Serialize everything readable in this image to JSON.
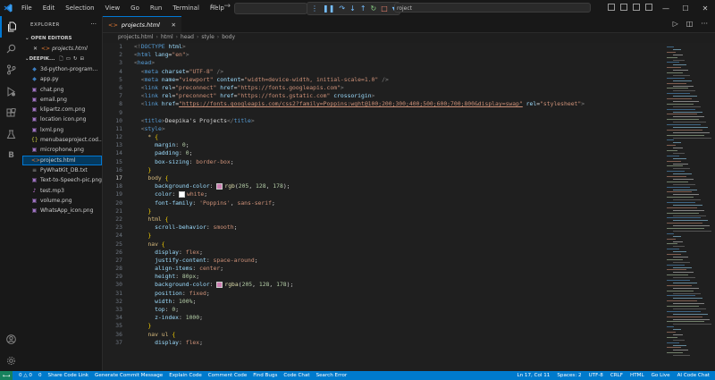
{
  "menu": [
    "File",
    "Edit",
    "Selection",
    "View",
    "Go",
    "Run",
    "Terminal",
    "Help"
  ],
  "command_center": "roject",
  "sidebar": {
    "title": "EXPLORER",
    "open_editors_title": "OPEN EDITORS",
    "open_file": "projects.html",
    "project_title": "DEEPIK...",
    "files": [
      {
        "name": "3d-python-program...",
        "kind": "py"
      },
      {
        "name": "app.py",
        "kind": "py"
      },
      {
        "name": "chat.png",
        "kind": "img"
      },
      {
        "name": "email.png",
        "kind": "img"
      },
      {
        "name": "klipartz.com.png",
        "kind": "img"
      },
      {
        "name": "location icon.png",
        "kind": "img"
      },
      {
        "name": "lxml.png",
        "kind": "img"
      },
      {
        "name": "menubaseproject.cod...",
        "kind": "json"
      },
      {
        "name": "microphone.png",
        "kind": "img"
      },
      {
        "name": "projects.html",
        "kind": "html",
        "selected": true
      },
      {
        "name": "PyWhatKit_DB.txt",
        "kind": "txt"
      },
      {
        "name": "Text-to-Speech-pic.png",
        "kind": "img"
      },
      {
        "name": "test.mp3",
        "kind": "mp3"
      },
      {
        "name": "volume.png",
        "kind": "img"
      },
      {
        "name": "WhatsApp_icon.png",
        "kind": "img"
      }
    ]
  },
  "tab": {
    "label": "projects.html"
  },
  "breadcrumb": [
    "projects.html",
    "html",
    "head",
    "style",
    "body"
  ],
  "editor": {
    "current_line": 17,
    "lines": [
      [
        [
          "t-pun",
          "<!"
        ],
        [
          "t-tag",
          "DOCTYPE"
        ],
        [
          "t-attr",
          " html"
        ],
        [
          "t-pun",
          ">"
        ]
      ],
      [
        [
          "t-pun",
          "<"
        ],
        [
          "t-tag",
          "html"
        ],
        [
          "t-attr",
          " lang"
        ],
        [
          "t-txt",
          "="
        ],
        [
          "t-str",
          "\"en\""
        ],
        [
          "t-pun",
          ">"
        ]
      ],
      [
        [
          "t-pun",
          "<"
        ],
        [
          "t-tag",
          "head"
        ],
        [
          "t-pun",
          ">"
        ]
      ],
      [
        [
          "t-txt",
          "  "
        ],
        [
          "t-pun",
          "<"
        ],
        [
          "t-tag",
          "meta"
        ],
        [
          "t-attr",
          " charset"
        ],
        [
          "t-txt",
          "="
        ],
        [
          "t-str",
          "\"UTF-8\""
        ],
        [
          "t-pun",
          " />"
        ]
      ],
      [
        [
          "t-txt",
          "  "
        ],
        [
          "t-pun",
          "<"
        ],
        [
          "t-tag",
          "meta"
        ],
        [
          "t-attr",
          " name"
        ],
        [
          "t-txt",
          "="
        ],
        [
          "t-str",
          "\"viewport\""
        ],
        [
          "t-attr",
          " content"
        ],
        [
          "t-txt",
          "="
        ],
        [
          "t-str",
          "\"width=device-width, initial-scale=1.0\""
        ],
        [
          "t-pun",
          " />"
        ]
      ],
      [
        [
          "t-txt",
          "  "
        ],
        [
          "t-pun",
          "<"
        ],
        [
          "t-tag",
          "link"
        ],
        [
          "t-attr",
          " rel"
        ],
        [
          "t-txt",
          "="
        ],
        [
          "t-str",
          "\"preconnect\""
        ],
        [
          "t-attr",
          " href"
        ],
        [
          "t-txt",
          "="
        ],
        [
          "t-str",
          "\"https://fonts.googleapis.com\""
        ],
        [
          "t-pun",
          ">"
        ]
      ],
      [
        [
          "t-txt",
          "  "
        ],
        [
          "t-pun",
          "<"
        ],
        [
          "t-tag",
          "link"
        ],
        [
          "t-attr",
          " rel"
        ],
        [
          "t-txt",
          "="
        ],
        [
          "t-str",
          "\"preconnect\""
        ],
        [
          "t-attr",
          " href"
        ],
        [
          "t-txt",
          "="
        ],
        [
          "t-str",
          "\"https://fonts.gstatic.com\""
        ],
        [
          "t-attr",
          " crossorigin"
        ],
        [
          "t-pun",
          ">"
        ]
      ],
      [
        [
          "t-txt",
          "  "
        ],
        [
          "t-pun",
          "<"
        ],
        [
          "t-tag",
          "link"
        ],
        [
          "t-attr",
          " href"
        ],
        [
          "t-txt",
          "="
        ],
        [
          "t-url",
          "\"https://fonts.googleapis.com/css2?family=Poppins:wght@100;200;300;400;500;600;700;800&display=swap\""
        ],
        [
          "t-attr",
          " rel"
        ],
        [
          "t-txt",
          "="
        ],
        [
          "t-str",
          "\"stylesheet\""
        ],
        [
          "t-pun",
          ">"
        ]
      ],
      [],
      [
        [
          "t-txt",
          "  "
        ],
        [
          "t-pun",
          "<"
        ],
        [
          "t-tag",
          "title"
        ],
        [
          "t-pun",
          ">"
        ],
        [
          "t-txt",
          "Deepika's Projects"
        ],
        [
          "t-pun",
          "</"
        ],
        [
          "t-tag",
          "title"
        ],
        [
          "t-pun",
          ">"
        ]
      ],
      [
        [
          "t-txt",
          "  "
        ],
        [
          "t-pun",
          "<"
        ],
        [
          "t-tag",
          "style"
        ],
        [
          "t-pun",
          ">"
        ]
      ],
      [
        [
          "t-txt",
          "    "
        ],
        [
          "t-sel",
          "* "
        ],
        [
          "t-brk",
          "{"
        ]
      ],
      [
        [
          "t-txt",
          "      "
        ],
        [
          "t-prop",
          "margin"
        ],
        [
          "t-txt",
          ": "
        ],
        [
          "t-num",
          "0"
        ],
        [
          "t-txt",
          ";"
        ]
      ],
      [
        [
          "t-txt",
          "      "
        ],
        [
          "t-prop",
          "padding"
        ],
        [
          "t-txt",
          ": "
        ],
        [
          "t-num",
          "0"
        ],
        [
          "t-txt",
          ";"
        ]
      ],
      [
        [
          "t-txt",
          "      "
        ],
        [
          "t-prop",
          "box-sizing"
        ],
        [
          "t-txt",
          ": "
        ],
        [
          "t-val",
          "border-box"
        ],
        [
          "t-txt",
          ";"
        ]
      ],
      [
        [
          "t-txt",
          "    "
        ],
        [
          "t-brk",
          "}"
        ]
      ],
      [
        [
          "t-txt",
          "    "
        ],
        [
          "t-sel",
          "body "
        ],
        [
          "t-brk",
          "{"
        ]
      ],
      [
        [
          "t-txt",
          "      "
        ],
        [
          "t-prop",
          "background-color"
        ],
        [
          "t-txt",
          ": "
        ],
        [
          "sw",
          "#cd80b2"
        ],
        [
          "t-fn",
          "rgb"
        ],
        [
          "t-txt",
          "("
        ],
        [
          "t-num",
          "205"
        ],
        [
          "t-txt",
          ", "
        ],
        [
          "t-num",
          "128"
        ],
        [
          "t-txt",
          ", "
        ],
        [
          "t-num",
          "178"
        ],
        [
          "t-txt",
          ");"
        ]
      ],
      [
        [
          "t-txt",
          "      "
        ],
        [
          "t-prop",
          "color"
        ],
        [
          "t-txt",
          ": "
        ],
        [
          "sw",
          "#ffffff"
        ],
        [
          "t-val",
          "white"
        ],
        [
          "t-txt",
          ";"
        ]
      ],
      [
        [
          "t-txt",
          "      "
        ],
        [
          "t-prop",
          "font-family"
        ],
        [
          "t-txt",
          ": "
        ],
        [
          "t-val",
          "'Poppins'"
        ],
        [
          "t-txt",
          ", "
        ],
        [
          "t-val",
          "sans-serif"
        ],
        [
          "t-txt",
          ";"
        ]
      ],
      [
        [
          "t-txt",
          "    "
        ],
        [
          "t-brk",
          "}"
        ]
      ],
      [
        [
          "t-txt",
          "    "
        ],
        [
          "t-sel",
          "html "
        ],
        [
          "t-brk",
          "{"
        ]
      ],
      [
        [
          "t-txt",
          "      "
        ],
        [
          "t-prop",
          "scroll-behavior"
        ],
        [
          "t-txt",
          ": "
        ],
        [
          "t-val",
          "smooth"
        ],
        [
          "t-txt",
          ";"
        ]
      ],
      [
        [
          "t-txt",
          "    "
        ],
        [
          "t-brk",
          "}"
        ]
      ],
      [
        [
          "t-txt",
          "    "
        ],
        [
          "t-sel",
          "nav "
        ],
        [
          "t-brk",
          "{"
        ]
      ],
      [
        [
          "t-txt",
          "      "
        ],
        [
          "t-prop",
          "display"
        ],
        [
          "t-txt",
          ": "
        ],
        [
          "t-val",
          "flex"
        ],
        [
          "t-txt",
          ";"
        ]
      ],
      [
        [
          "t-txt",
          "      "
        ],
        [
          "t-prop",
          "justify-content"
        ],
        [
          "t-txt",
          ": "
        ],
        [
          "t-val",
          "space-around"
        ],
        [
          "t-txt",
          ";"
        ]
      ],
      [
        [
          "t-txt",
          "      "
        ],
        [
          "t-prop",
          "align-items"
        ],
        [
          "t-txt",
          ": "
        ],
        [
          "t-val",
          "center"
        ],
        [
          "t-txt",
          ";"
        ]
      ],
      [
        [
          "t-txt",
          "      "
        ],
        [
          "t-prop",
          "height"
        ],
        [
          "t-txt",
          ": "
        ],
        [
          "t-num",
          "80px"
        ],
        [
          "t-txt",
          ";"
        ]
      ],
      [
        [
          "t-txt",
          "      "
        ],
        [
          "t-prop",
          "background-color"
        ],
        [
          "t-txt",
          ": "
        ],
        [
          "sw",
          "#cd80b2"
        ],
        [
          "t-fn",
          "rgba"
        ],
        [
          "t-txt",
          "("
        ],
        [
          "t-num",
          "205"
        ],
        [
          "t-txt",
          ", "
        ],
        [
          "t-num",
          "128"
        ],
        [
          "t-txt",
          ", "
        ],
        [
          "t-num",
          "178"
        ],
        [
          "t-txt",
          ");"
        ]
      ],
      [
        [
          "t-txt",
          "      "
        ],
        [
          "t-prop",
          "position"
        ],
        [
          "t-txt",
          ": "
        ],
        [
          "t-val",
          "fixed"
        ],
        [
          "t-txt",
          ";"
        ]
      ],
      [
        [
          "t-txt",
          "      "
        ],
        [
          "t-prop",
          "width"
        ],
        [
          "t-txt",
          ": "
        ],
        [
          "t-num",
          "100%"
        ],
        [
          "t-txt",
          ";"
        ]
      ],
      [
        [
          "t-txt",
          "      "
        ],
        [
          "t-prop",
          "top"
        ],
        [
          "t-txt",
          ": "
        ],
        [
          "t-num",
          "0"
        ],
        [
          "t-txt",
          ";"
        ]
      ],
      [
        [
          "t-txt",
          "      "
        ],
        [
          "t-prop",
          "z-index"
        ],
        [
          "t-txt",
          ": "
        ],
        [
          "t-num",
          "1000"
        ],
        [
          "t-txt",
          ";"
        ]
      ],
      [
        [
          "t-txt",
          "    "
        ],
        [
          "t-brk",
          "}"
        ]
      ],
      [
        [
          "t-txt",
          "    "
        ],
        [
          "t-sel",
          "nav ul "
        ],
        [
          "t-brk",
          "{"
        ]
      ],
      [
        [
          "t-txt",
          "      "
        ],
        [
          "t-prop",
          "display"
        ],
        [
          "t-txt",
          ": "
        ],
        [
          "t-val",
          "flex"
        ],
        [
          "t-txt",
          ";"
        ]
      ]
    ]
  },
  "status": {
    "left": [
      "0 △ 0",
      "0",
      "Share Code Link",
      "Generate Commit Message",
      "Explain Code",
      "Comment Code",
      "Find Bugs",
      "Code Chat",
      "Search Error"
    ],
    "right": [
      "Ln 17, Col 11",
      "Spaces: 2",
      "UTF-8",
      "CRLF",
      "HTML",
      "Go Live",
      "AI Code Chat"
    ]
  },
  "colors": {
    "accent": "#007acc",
    "selection": "#04395e"
  }
}
